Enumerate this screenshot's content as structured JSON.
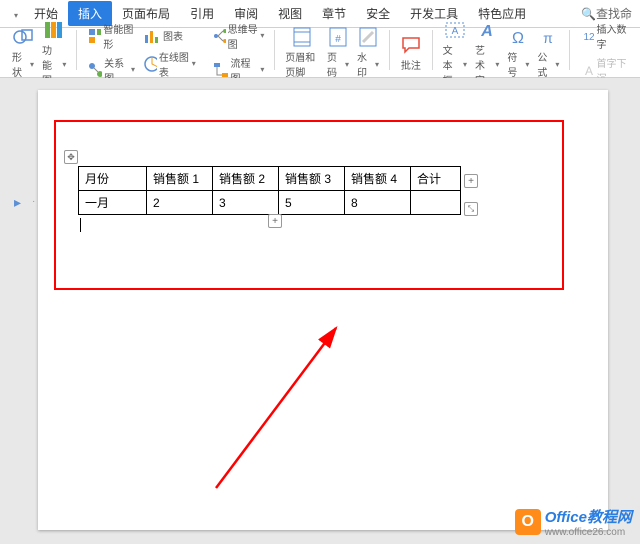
{
  "tabs": {
    "dropdown_icon": "▾",
    "items": [
      "开始",
      "插入",
      "页面布局",
      "引用",
      "审阅",
      "视图",
      "章节",
      "安全",
      "开发工具",
      "特色应用"
    ],
    "active_index": 1
  },
  "search": {
    "icon": "🔍",
    "label": "查找命"
  },
  "ribbon": {
    "shape": "形状",
    "gallery": "功能图",
    "smartart": "智能图形",
    "chart": "图表",
    "relation": "关系图",
    "online_chart": "在线图表",
    "mindmap": "思维导图",
    "flowchart": "流程图",
    "header_footer": "页眉和页脚",
    "page_number": "页码",
    "watermark": "水印",
    "comment": "批注",
    "textbox": "文本框",
    "wordart": "艺术字",
    "symbol": "符号",
    "formula": "公式",
    "insert_number": "插入数字",
    "header_next": "首字下沉"
  },
  "table": {
    "headers": [
      "月份",
      "销售额 1",
      "销售额 2",
      "销售额 3",
      "销售额 4",
      "合计"
    ],
    "row1": [
      "一月",
      "2",
      "3",
      "5",
      "8",
      ""
    ]
  },
  "handles": {
    "move": "✥",
    "plus": "+",
    "resize": "⤡"
  },
  "nav": {
    "icon": "▸",
    "dash": "·"
  },
  "watermark_brand": {
    "logo": "O",
    "title": "Office教程网",
    "url": "www.office26.com"
  }
}
